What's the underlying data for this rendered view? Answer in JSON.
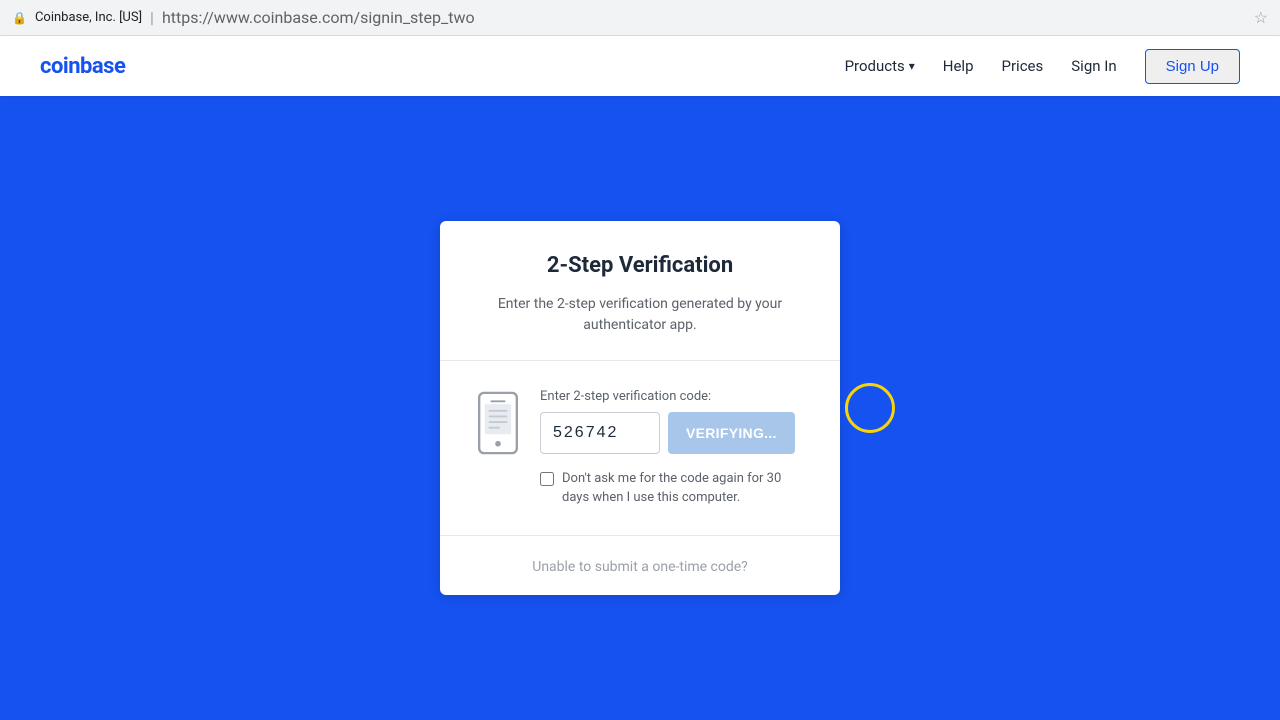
{
  "browser": {
    "lock_icon": "🔒",
    "company": "Coinbase, Inc. [US]",
    "separator": "|",
    "url": "https://www.coinbase.com/signin_step_two",
    "star_icon": "☆"
  },
  "navbar": {
    "logo": "coinbase",
    "nav": {
      "products_label": "Products",
      "help_label": "Help",
      "prices_label": "Prices",
      "signin_label": "Sign In",
      "signup_label": "Sign Up"
    }
  },
  "card": {
    "title": "2-Step Verification",
    "description": "Enter the 2-step verification generated by your authenticator app.",
    "input_label": "Enter 2-step verification code:",
    "input_value": "526742",
    "verify_button_label": "VERIFYING...",
    "checkbox_label": "Don't ask me for the code again for 30 days when I use this computer.",
    "footer_link": "Unable to submit a one-time code?"
  },
  "colors": {
    "accent": "#1652f0",
    "button_disabled": "#a8c5ea",
    "cursor": "#f7d30a"
  }
}
